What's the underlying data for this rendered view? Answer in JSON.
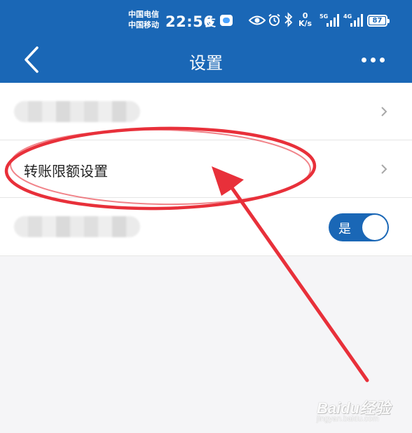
{
  "status_bar": {
    "carrier_1": "中国电信",
    "carrier_2": "中国移动",
    "time": "22:56",
    "alipay_glyph": "支",
    "speed_value": "0",
    "speed_unit": "K/s",
    "signal_1_gen": "5G",
    "signal_2_gen": "4G",
    "battery_level": "87",
    "icons": [
      "alipay-icon",
      "weather-icon",
      "eye-icon",
      "alarm-icon",
      "bluetooth-icon",
      "signal-icon",
      "battery-icon"
    ]
  },
  "nav": {
    "title": "设置",
    "back_icon": "chevron-left-icon",
    "more_icon": "more-dots-icon"
  },
  "settings": {
    "items": [
      {
        "label": ""
      },
      {
        "label": "转账限额设置"
      },
      {
        "label": "",
        "toggle_label": "是",
        "toggle_on": true
      }
    ]
  },
  "watermark": {
    "text": "Baidu经验",
    "subtext": "jingyan.baidu.com"
  },
  "colors": {
    "brand_blue": "#1a67b6",
    "annotation_red": "#e8303a",
    "background": "#f5f5f7"
  }
}
